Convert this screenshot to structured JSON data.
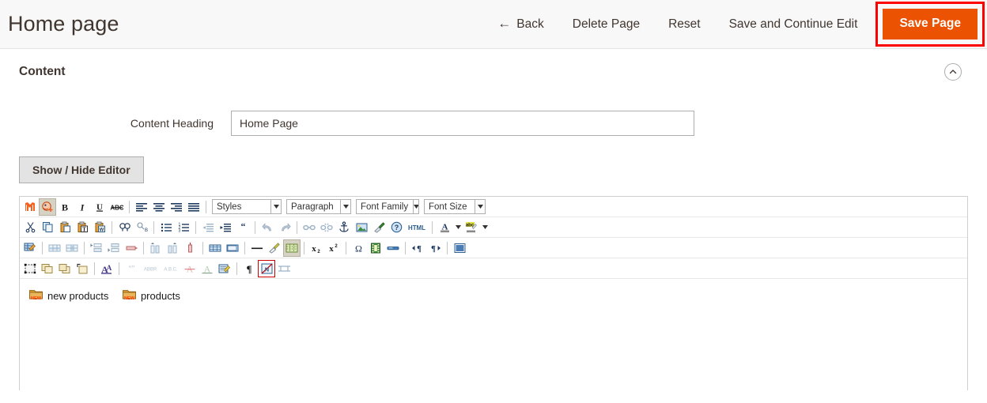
{
  "header": {
    "title": "Home page",
    "actions": [
      {
        "id": "back",
        "label": "Back",
        "icon": "arrow-left-icon",
        "style": "link"
      },
      {
        "id": "delete-page",
        "label": "Delete Page",
        "icon": "",
        "style": "link"
      },
      {
        "id": "reset",
        "label": "Reset",
        "icon": "",
        "style": "link"
      },
      {
        "id": "save-continue",
        "label": "Save and Continue Edit",
        "icon": "",
        "style": "link"
      },
      {
        "id": "save-page",
        "label": "Save Page",
        "icon": "",
        "style": "primary"
      }
    ],
    "back_arrow_glyph": "←"
  },
  "section": {
    "title": "Content",
    "collapse_icon": "chevron-up-icon"
  },
  "form": {
    "content_heading": {
      "label": "Content Heading",
      "value": "Home Page",
      "placeholder": ""
    },
    "editor_toggle_label": "Show / Hide Editor"
  },
  "editor": {
    "selects": [
      {
        "id": "styles",
        "label": "Styles"
      },
      {
        "id": "paragraph",
        "label": "Paragraph"
      },
      {
        "id": "font-family",
        "label": "Font Family"
      },
      {
        "id": "font-size",
        "label": "Font Size"
      }
    ],
    "toolbar_rows": [
      {
        "id": "row-1",
        "items": [
          {
            "name": "magento-variable-icon",
            "type": "button"
          },
          {
            "name": "magento-widget-icon",
            "type": "button",
            "active": true
          },
          {
            "name": "bold-icon",
            "type": "button"
          },
          {
            "name": "italic-icon",
            "type": "button"
          },
          {
            "name": "underline-icon",
            "type": "button"
          },
          {
            "name": "strikethrough-icon",
            "type": "button"
          },
          {
            "name": "separator",
            "type": "sep"
          },
          {
            "name": "align-left-icon",
            "type": "button"
          },
          {
            "name": "align-center-icon",
            "type": "button"
          },
          {
            "name": "align-right-icon",
            "type": "button"
          },
          {
            "name": "align-justify-icon",
            "type": "button"
          },
          {
            "name": "separator",
            "type": "sep"
          }
        ]
      },
      {
        "id": "row-2",
        "items": [
          {
            "name": "cut-icon",
            "type": "button"
          },
          {
            "name": "copy-icon",
            "type": "button"
          },
          {
            "name": "paste-icon",
            "type": "button"
          },
          {
            "name": "paste-text-icon",
            "type": "button"
          },
          {
            "name": "paste-word-icon",
            "type": "button"
          },
          {
            "name": "separator",
            "type": "sep"
          },
          {
            "name": "search-icon",
            "type": "button"
          },
          {
            "name": "search-replace-icon",
            "type": "button"
          },
          {
            "name": "separator",
            "type": "sep"
          },
          {
            "name": "bullet-list-icon",
            "type": "button"
          },
          {
            "name": "numbered-list-icon",
            "type": "button"
          },
          {
            "name": "separator",
            "type": "sep"
          },
          {
            "name": "outdent-icon",
            "type": "button"
          },
          {
            "name": "indent-icon",
            "type": "button"
          },
          {
            "name": "blockquote-icon",
            "type": "button"
          },
          {
            "name": "separator",
            "type": "sep"
          },
          {
            "name": "undo-icon",
            "type": "button"
          },
          {
            "name": "redo-icon",
            "type": "button"
          },
          {
            "name": "separator",
            "type": "sep"
          },
          {
            "name": "link-icon",
            "type": "button"
          },
          {
            "name": "unlink-icon",
            "type": "button"
          },
          {
            "name": "anchor-icon",
            "type": "button"
          },
          {
            "name": "image-icon",
            "type": "button"
          },
          {
            "name": "cleanup-icon",
            "type": "button"
          },
          {
            "name": "help-icon",
            "type": "button"
          },
          {
            "name": "html-source-icon",
            "type": "button",
            "text": "HTML"
          },
          {
            "name": "separator",
            "type": "sep"
          },
          {
            "name": "text-color-icon",
            "type": "split"
          },
          {
            "name": "background-color-icon",
            "type": "split"
          }
        ]
      },
      {
        "id": "row-3",
        "items": [
          {
            "name": "insert-table-icon",
            "type": "button"
          },
          {
            "name": "separator",
            "type": "sep"
          },
          {
            "name": "table-row-properties-icon",
            "type": "button"
          },
          {
            "name": "table-cell-properties-icon",
            "type": "button"
          },
          {
            "name": "separator",
            "type": "sep"
          },
          {
            "name": "insert-row-before-icon",
            "type": "button"
          },
          {
            "name": "insert-row-after-icon",
            "type": "button"
          },
          {
            "name": "delete-row-icon",
            "type": "button"
          },
          {
            "name": "separator",
            "type": "sep"
          },
          {
            "name": "insert-column-before-icon",
            "type": "button"
          },
          {
            "name": "insert-column-after-icon",
            "type": "button"
          },
          {
            "name": "delete-column-icon",
            "type": "button"
          },
          {
            "name": "separator",
            "type": "sep"
          },
          {
            "name": "split-cells-icon",
            "type": "button"
          },
          {
            "name": "merge-cells-icon",
            "type": "button"
          },
          {
            "name": "separator",
            "type": "sep"
          },
          {
            "name": "horizontal-rule-icon",
            "type": "button"
          },
          {
            "name": "remove-format-icon",
            "type": "button"
          },
          {
            "name": "visual-aid-icon",
            "type": "button",
            "active": true
          },
          {
            "name": "separator",
            "type": "sep"
          },
          {
            "name": "subscript-icon",
            "type": "button"
          },
          {
            "name": "superscript-icon",
            "type": "button"
          },
          {
            "name": "separator",
            "type": "sep"
          },
          {
            "name": "special-character-icon",
            "type": "button"
          },
          {
            "name": "insert-media-icon",
            "type": "button"
          },
          {
            "name": "page-break-icon",
            "type": "button"
          },
          {
            "name": "separator",
            "type": "sep"
          },
          {
            "name": "ltr-direction-icon",
            "type": "button"
          },
          {
            "name": "rtl-direction-icon",
            "type": "button"
          },
          {
            "name": "separator",
            "type": "sep"
          },
          {
            "name": "fullscreen-icon",
            "type": "button"
          }
        ]
      },
      {
        "id": "row-4",
        "items": [
          {
            "name": "insert-layer-icon",
            "type": "button"
          },
          {
            "name": "move-forward-icon",
            "type": "button"
          },
          {
            "name": "move-backward-icon",
            "type": "button"
          },
          {
            "name": "absolute-position-icon",
            "type": "button"
          },
          {
            "name": "separator",
            "type": "sep"
          },
          {
            "name": "style-properties-icon",
            "type": "button"
          },
          {
            "name": "separator",
            "type": "sep"
          },
          {
            "name": "citation-icon",
            "type": "button"
          },
          {
            "name": "abbreviation-icon",
            "type": "button"
          },
          {
            "name": "acronym-icon",
            "type": "button"
          },
          {
            "name": "deleted-text-icon",
            "type": "button"
          },
          {
            "name": "inserted-text-icon",
            "type": "button"
          },
          {
            "name": "attributes-icon",
            "type": "button"
          },
          {
            "name": "separator",
            "type": "sep"
          },
          {
            "name": "visual-characters-icon",
            "type": "button"
          },
          {
            "name": "nonbreaking-space-icon",
            "type": "button",
            "highlight": true
          },
          {
            "name": "page-break-insert-icon",
            "type": "button"
          }
        ]
      }
    ],
    "body_widgets": [
      {
        "name": "widget-new-products",
        "label": "new products",
        "icon": "widget-folder-new-icon"
      },
      {
        "name": "widget-products",
        "label": "products",
        "icon": "widget-folder-new-icon"
      }
    ]
  },
  "colors": {
    "primary": "#eb5202",
    "highlight": "#ff0000",
    "text": "#41362f",
    "header_bg": "#f8f8f8",
    "border": "#adadad"
  }
}
